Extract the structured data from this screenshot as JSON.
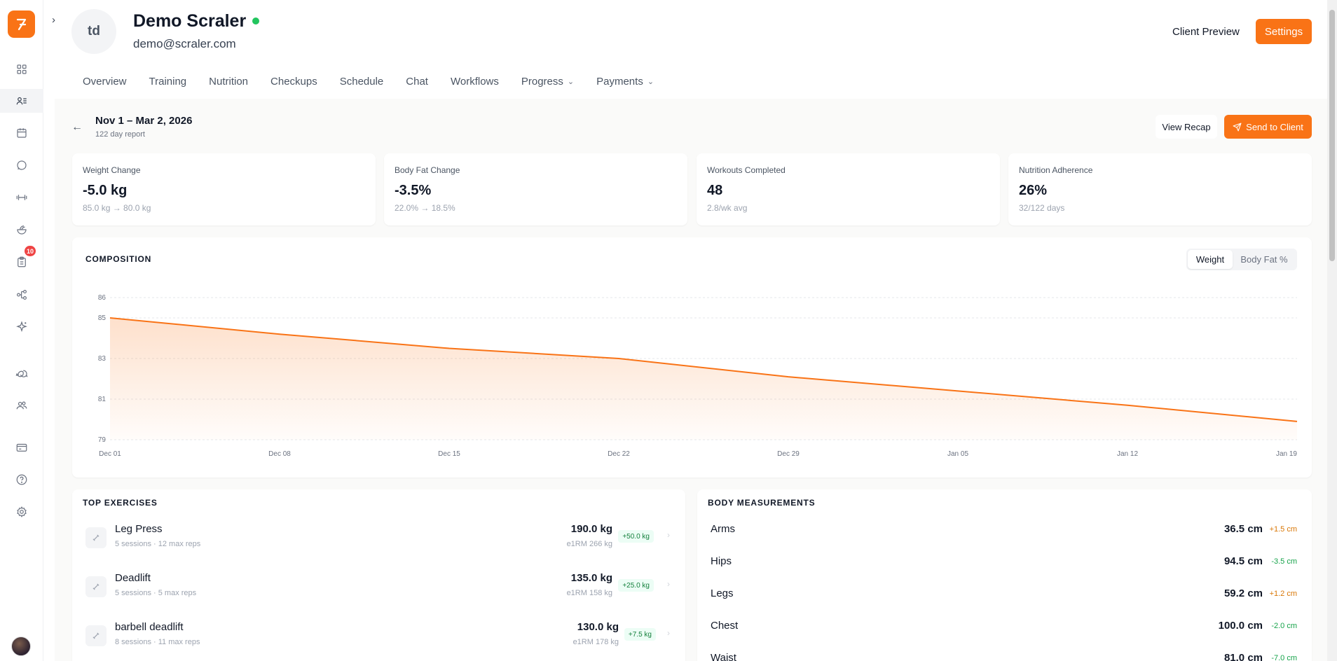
{
  "sidebar": {
    "badge_count": "10",
    "items": [
      {
        "icon": "dashboard-grid-icon"
      },
      {
        "icon": "clients-icon",
        "active": true
      },
      {
        "icon": "calendar-icon"
      },
      {
        "icon": "chat-bubble-icon"
      },
      {
        "icon": "dumbbell-icon"
      },
      {
        "icon": "nutrition-bowl-icon"
      },
      {
        "icon": "clipboard-icon"
      },
      {
        "icon": "workflow-icon"
      },
      {
        "icon": "sparkle-icon"
      },
      {
        "icon": "messages-icon"
      },
      {
        "icon": "team-icon"
      },
      {
        "icon": "billing-card-icon"
      },
      {
        "icon": "help-icon"
      },
      {
        "icon": "settings-gear-icon"
      }
    ]
  },
  "client": {
    "initials": "td",
    "name": "Demo Scraler",
    "email": "demo@scraler.com",
    "status_color": "#22c55e"
  },
  "header": {
    "preview_label": "Client Preview",
    "settings_label": "Settings"
  },
  "tabs": [
    {
      "label": "Overview"
    },
    {
      "label": "Training"
    },
    {
      "label": "Nutrition"
    },
    {
      "label": "Checkups"
    },
    {
      "label": "Schedule"
    },
    {
      "label": "Chat"
    },
    {
      "label": "Workflows"
    },
    {
      "label": "Progress"
    },
    {
      "label": "Payments"
    }
  ],
  "report": {
    "range": "Nov 1 – Mar 2, 2026",
    "days": "122 day report",
    "recap_label": "View Recap",
    "send_label": "Send to Client"
  },
  "stats": [
    {
      "label": "Weight Change",
      "value": "-5.0 kg",
      "sub": "85.0 kg → 80.0 kg"
    },
    {
      "label": "Body Fat Change",
      "value": "-3.5%",
      "sub": "22.0% → 18.5%"
    },
    {
      "label": "Workouts Completed",
      "value": "48",
      "sub": "2.8/wk avg"
    },
    {
      "label": "Nutrition Adherence",
      "value": "26%",
      "sub": "32/122 days"
    }
  ],
  "composition": {
    "title": "COMPOSITION",
    "toggle_weight": "Weight",
    "toggle_bodyfat": "Body Fat %"
  },
  "chart_data": {
    "type": "area",
    "title": "COMPOSITION",
    "x": [
      "Dec 01",
      "Dec 08",
      "Dec 15",
      "Dec 22",
      "Dec 29",
      "Jan 05",
      "Jan 12",
      "Jan 19"
    ],
    "values": [
      85.0,
      84.2,
      83.5,
      83.0,
      82.1,
      81.4,
      80.7,
      79.9
    ],
    "yticks": [
      79,
      81,
      83,
      85,
      86
    ],
    "ylim": [
      79,
      86
    ],
    "xlabel": "",
    "ylabel": "",
    "grid": true,
    "color": "#f97316"
  },
  "exercises": {
    "title": "TOP EXERCISES",
    "items": [
      {
        "name": "Leg Press",
        "meta": "5 sessions · 12 max reps",
        "weight": "190.0 kg",
        "e1rm": "e1RM 266 kg",
        "delta": "+50.0 kg"
      },
      {
        "name": "Deadlift",
        "meta": "5 sessions · 5 max reps",
        "weight": "135.0 kg",
        "e1rm": "e1RM 158 kg",
        "delta": "+25.0 kg"
      },
      {
        "name": "barbell deadlift",
        "meta": "8 sessions · 11 max reps",
        "weight": "130.0 kg",
        "e1rm": "e1RM 178 kg",
        "delta": "+7.5 kg"
      }
    ]
  },
  "measurements": {
    "title": "BODY MEASUREMENTS",
    "items": [
      {
        "name": "Arms",
        "value": "36.5 cm",
        "delta": "+1.5 cm",
        "color": "#d97706"
      },
      {
        "name": "Hips",
        "value": "94.5 cm",
        "delta": "-3.5 cm",
        "color": "#16a34a"
      },
      {
        "name": "Legs",
        "value": "59.2 cm",
        "delta": "+1.2 cm",
        "color": "#d97706"
      },
      {
        "name": "Chest",
        "value": "100.0 cm",
        "delta": "-2.0 cm",
        "color": "#16a34a"
      },
      {
        "name": "Waist",
        "value": "81.0 cm",
        "delta": "-7.0 cm",
        "color": "#16a34a"
      }
    ]
  },
  "colors": {
    "accent": "#f97316",
    "positive": "#16a34a",
    "warning": "#d97706"
  }
}
